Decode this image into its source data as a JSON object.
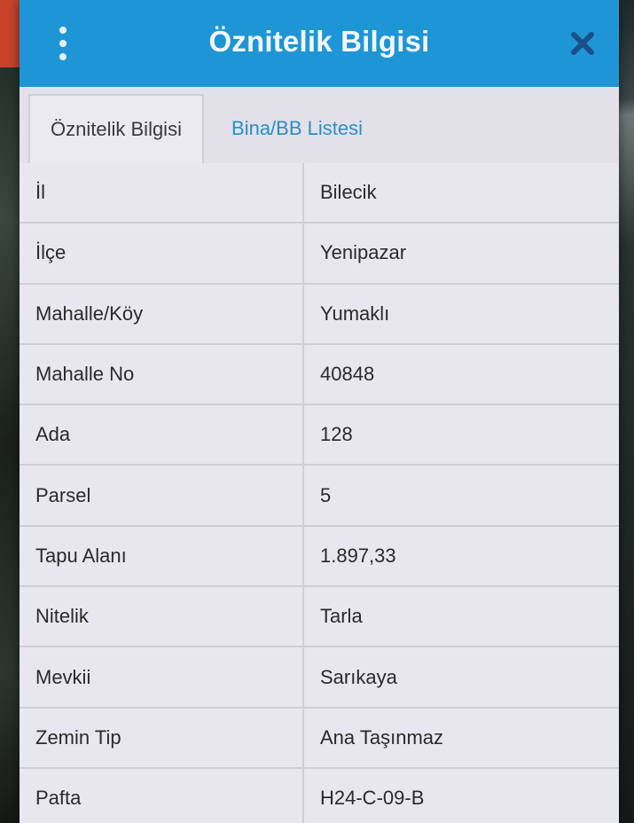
{
  "dialog": {
    "title": "Öznitelik Bilgisi",
    "menu_icon": "more-vertical-icon",
    "close_icon": "close-icon",
    "header_color": "#1e96d6",
    "accent_text_color": "#2a8fc6"
  },
  "tabs": [
    {
      "label": "Öznitelik Bilgisi",
      "active": true
    },
    {
      "label": "Bina/BB Listesi",
      "active": false
    }
  ],
  "rows": [
    {
      "label": "İl",
      "value": "Bilecik"
    },
    {
      "label": "İlçe",
      "value": "Yenipazar"
    },
    {
      "label": "Mahalle/Köy",
      "value": "Yumaklı"
    },
    {
      "label": "Mahalle No",
      "value": "40848"
    },
    {
      "label": "Ada",
      "value": "128"
    },
    {
      "label": "Parsel",
      "value": "5"
    },
    {
      "label": "Tapu Alanı",
      "value": "1.897,33"
    },
    {
      "label": "Nitelik",
      "value": "Tarla"
    },
    {
      "label": "Mevkii",
      "value": "Sarıkaya"
    },
    {
      "label": "Zemin Tip",
      "value": "Ana Taşınmaz"
    },
    {
      "label": "Pafta",
      "value": "H24-C-09-B"
    }
  ]
}
